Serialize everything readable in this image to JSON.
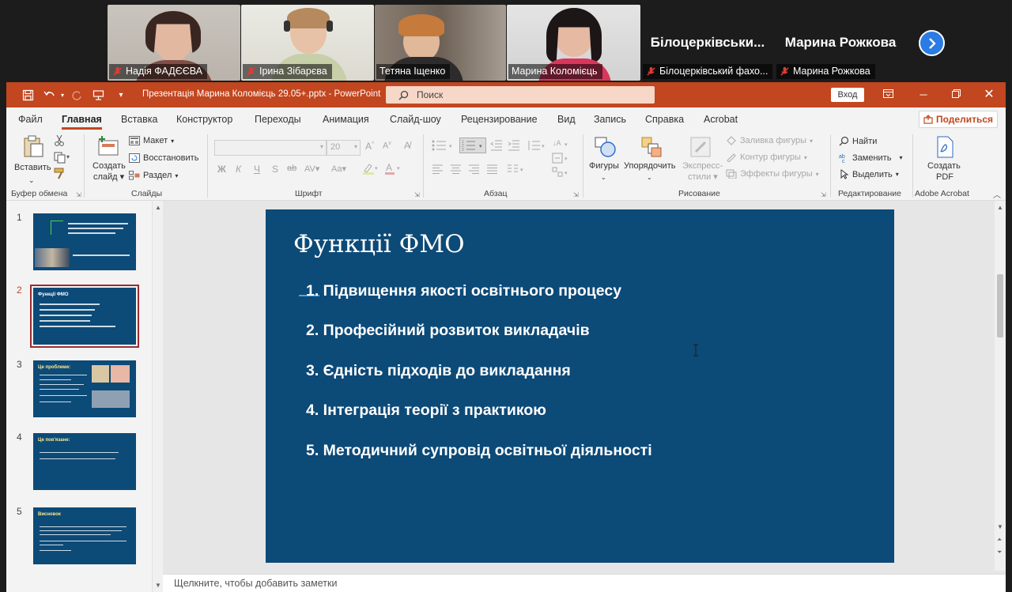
{
  "meeting": {
    "participants": [
      {
        "name": "Надія ФАДЄЄВА"
      },
      {
        "name": "Ірина Зібарєва"
      },
      {
        "name": "Тетяна Іщенко"
      },
      {
        "name": "Марина Коломієць"
      },
      {
        "display_name": "Білоцерківськи...",
        "name": "Білоцерківський фахо..."
      },
      {
        "display_name": "Марина Рожкова",
        "name": "Марина Рожкова"
      }
    ],
    "next_icon": "chevron-right-icon"
  },
  "powerpoint": {
    "title": "Презентація Марина Коломієць 29.05+.pptx  -  PowerPoint",
    "search_placeholder": "Поиск",
    "signin_label": "Вход",
    "share_label": "Поделиться",
    "accent_color": "#c2461f",
    "menu": [
      "Файл",
      "Главная",
      "Вставка",
      "Конструктор",
      "Переходы",
      "Анимация",
      "Слайд-шоу",
      "Рецензирование",
      "Вид",
      "Запись",
      "Справка",
      "Acrobat"
    ],
    "active_menu": "Главная",
    "ribbon": {
      "clipboard": {
        "paste": "Вставить",
        "group": "Буфер обмена"
      },
      "slides": {
        "new_slide_1": "Создать",
        "new_slide_2": "слайд",
        "layout": "Макет",
        "reset": "Восстановить",
        "section": "Раздел",
        "group": "Слайды"
      },
      "font": {
        "size": "20",
        "bold": "Ж",
        "italic": "К",
        "underline": "Ч",
        "strike": "S",
        "abc": "ab",
        "spacing": "AV",
        "case": "Aa",
        "group": "Шрифт"
      },
      "paragraph": {
        "group": "Абзац"
      },
      "drawing": {
        "shapes": "Фигуры",
        "arrange": "Упорядочить",
        "quick_styles_1": "Экспресс-",
        "quick_styles_2": "стили",
        "fill": "Заливка фигуры",
        "outline": "Контур фигуры",
        "effects": "Эффекты фигуры",
        "group": "Рисование"
      },
      "editing": {
        "find": "Найти",
        "replace": "Заменить",
        "select": "Выделить",
        "group": "Редактирование"
      },
      "acrobat": {
        "create_1": "Создать",
        "create_2": "PDF",
        "group": "Adobe Acrobat"
      }
    },
    "thumbnails": [
      {
        "number": "1"
      },
      {
        "number": "2",
        "title": "Функції ФМО"
      },
      {
        "number": "3",
        "title": "Це проблеми:"
      },
      {
        "number": "4",
        "title": "Це пов'язане:"
      },
      {
        "number": "5",
        "title": "Висновок"
      }
    ],
    "selected_slide": "2",
    "slide": {
      "title": "Функції ФМО",
      "items": [
        "1. Підвищення якості освітнього процесу",
        "2. Професійний розвиток викладачів",
        "3. Єдність підходів до викладання",
        "4. Інтеграція теорії з практикою",
        "5. Методичний супровід освітньої діяльності"
      ],
      "background": "#0c4a78"
    },
    "notes_placeholder": "Щелкните, чтобы добавить заметки"
  }
}
